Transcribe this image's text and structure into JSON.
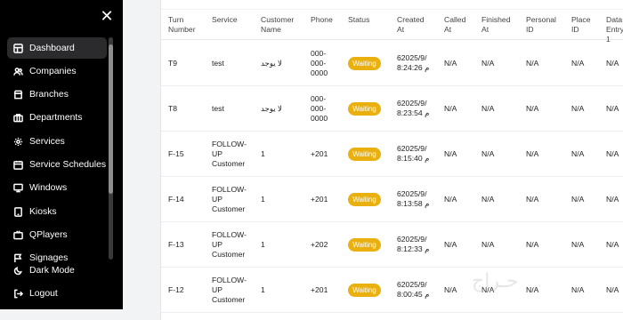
{
  "sidebar": {
    "items": [
      {
        "label": "Dashboard",
        "icon": "dashboard-icon"
      },
      {
        "label": "Companies",
        "icon": "users-icon"
      },
      {
        "label": "Branches",
        "icon": "store-icon"
      },
      {
        "label": "Departments",
        "icon": "briefcase-icon"
      },
      {
        "label": "Services",
        "icon": "gear-icon"
      },
      {
        "label": "Service Schedules",
        "icon": "calendar-icon"
      },
      {
        "label": "Windows",
        "icon": "monitor-icon"
      },
      {
        "label": "Kiosks",
        "icon": "tablet-icon"
      },
      {
        "label": "QPlayers",
        "icon": "tv-icon"
      },
      {
        "label": "Signages",
        "icon": "flag-icon"
      }
    ],
    "dark_mode_label": "Dark Mode",
    "logout_label": "Logout"
  },
  "table": {
    "headers": [
      "Turn\nNumber",
      "Service",
      "Customer\nName",
      "Phone",
      "Status",
      "Created\nAt",
      "Called\nAt",
      "Finished\nAt",
      "Personal\nID",
      "Place\nID",
      "Data\nEntry\n1"
    ],
    "rows": [
      {
        "turn": "T9",
        "service": "test",
        "customer": "لا يوجد",
        "phone": "000-\n000-\n0000",
        "status": "Waiting",
        "created": "62025/9/\n8:24:26 م",
        "called": "N/A",
        "finished": "N/A",
        "personal": "N/A",
        "place": "N/A",
        "entry": "N/A"
      },
      {
        "turn": "T8",
        "service": "test",
        "customer": "لا يوجد",
        "phone": "000-\n000-\n0000",
        "status": "Waiting",
        "created": "62025/9/\n8:23:54 م",
        "called": "N/A",
        "finished": "N/A",
        "personal": "N/A",
        "place": "N/A",
        "entry": "N/A"
      },
      {
        "turn": "F-15",
        "service": "FOLLOW-\nUP\nCustomer",
        "customer": "1",
        "phone": "+201",
        "status": "Waiting",
        "created": "62025/9/\n8:15:40 م",
        "called": "N/A",
        "finished": "N/A",
        "personal": "N/A",
        "place": "N/A",
        "entry": "N/A"
      },
      {
        "turn": "F-14",
        "service": "FOLLOW-\nUP\nCustomer",
        "customer": "1",
        "phone": "+201",
        "status": "Waiting",
        "created": "62025/9/\n8:13:58 م",
        "called": "N/A",
        "finished": "N/A",
        "personal": "N/A",
        "place": "N/A",
        "entry": "N/A"
      },
      {
        "turn": "F-13",
        "service": "FOLLOW-\nUP\nCustomer",
        "customer": "1",
        "phone": "+202",
        "status": "Waiting",
        "created": "62025/9/\n8:12:33 م",
        "called": "N/A",
        "finished": "N/A",
        "personal": "N/A",
        "place": "N/A",
        "entry": "N/A"
      },
      {
        "turn": "F-12",
        "service": "FOLLOW-\nUP\nCustomer",
        "customer": "1",
        "phone": "+201",
        "status": "Waiting",
        "created": "62025/9/\n8:00:45 م",
        "called": "N/A",
        "finished": "N/A",
        "personal": "N/A",
        "place": "N/A",
        "entry": "N/A"
      }
    ]
  },
  "colors": {
    "accent": "#e9b010",
    "sidebar_bg": "#000000",
    "active_item_bg": "#2b2b2e"
  }
}
